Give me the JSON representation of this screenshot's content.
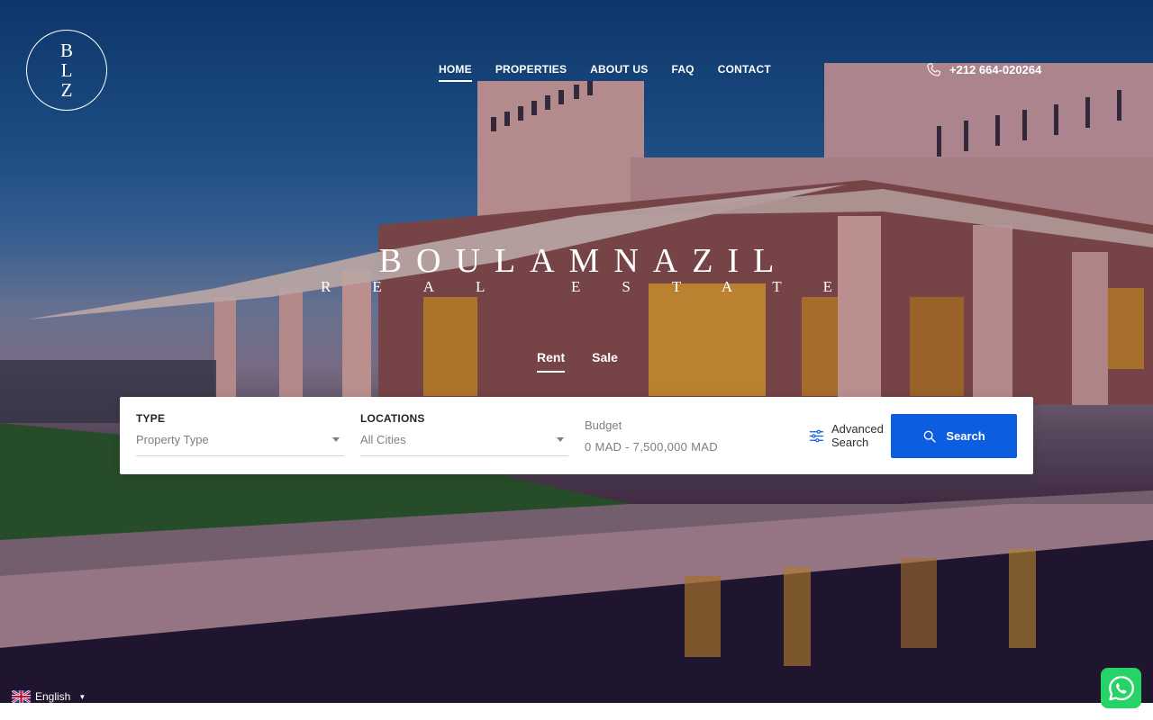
{
  "logo": {
    "letters": [
      "B",
      "L",
      "Z"
    ]
  },
  "nav": {
    "items": [
      {
        "label": "HOME",
        "active": true
      },
      {
        "label": "PROPERTIES",
        "active": false
      },
      {
        "label": "ABOUT US",
        "active": false
      },
      {
        "label": "FAQ",
        "active": false
      },
      {
        "label": "CONTACT",
        "active": false
      }
    ]
  },
  "contact": {
    "phone": "+212 664-020264",
    "icon": "phone-icon"
  },
  "brand": {
    "title": "BOULAMNAZIL",
    "subtitle": "REAL ESTATE"
  },
  "tabs": [
    {
      "label": "Rent",
      "active": true
    },
    {
      "label": "Sale",
      "active": false
    }
  ],
  "search": {
    "type": {
      "label": "TYPE",
      "value": "Property Type"
    },
    "locations": {
      "label": "LOCATIONS",
      "value": "All Cities"
    },
    "budget": {
      "label": "Budget",
      "range": "0 MAD - 7,500,000 MAD"
    },
    "advanced": {
      "line1": "Advanced",
      "line2": "Search",
      "icon": "sliders-icon"
    },
    "button": {
      "label": "Search",
      "icon": "search-icon"
    }
  },
  "language": {
    "label": "English",
    "icon": "uk-flag-icon"
  },
  "whatsapp": {
    "icon": "whatsapp-icon"
  },
  "colors": {
    "accent": "#0d5de0",
    "whatsapp": "#25d366",
    "white": "#ffffff"
  }
}
